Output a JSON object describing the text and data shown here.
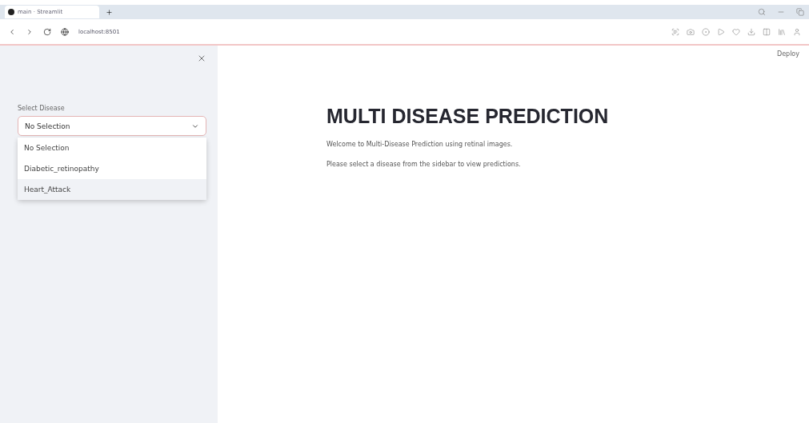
{
  "browser": {
    "tab_title": "main · Streamlit",
    "address": "localhost:8501"
  },
  "sidebar": {
    "select": {
      "label": "Select Disease",
      "value": "No Selection",
      "expanded": true,
      "options": [
        {
          "label": "No Selection",
          "highlighted": false
        },
        {
          "label": "Diabetic_retinopathy",
          "highlighted": false
        },
        {
          "label": "Heart_Attack",
          "highlighted": true
        }
      ]
    }
  },
  "header": {
    "deploy": "Deploy"
  },
  "main": {
    "title": "MULTI DISEASE PREDICTION",
    "paragraphs": [
      "Welcome to Multi-Disease Prediction using retinal images.",
      "Please select a disease from the sidebar to view predictions."
    ]
  }
}
